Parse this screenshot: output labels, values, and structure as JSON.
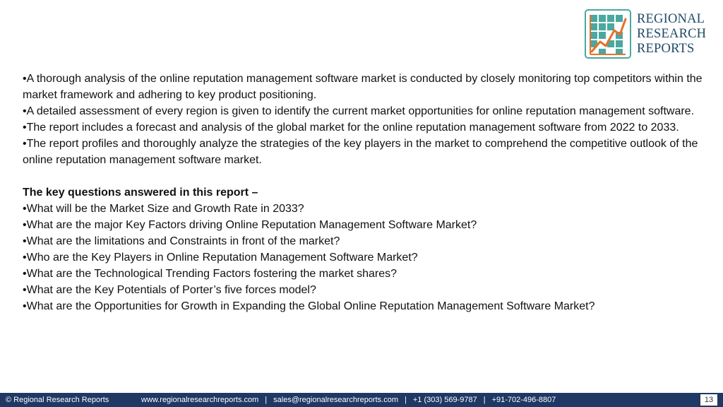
{
  "logo": {
    "icon": "bar-chart-growth-icon",
    "line1": "REGIONAL",
    "line2": "RESEARCH",
    "line3": "REPORTS",
    "colors": {
      "teal": "#4aa8a0",
      "orange": "#e8702a",
      "navy": "#1f4a66"
    }
  },
  "bullets": [
    "•A thorough analysis of the online reputation management software market is conducted by closely monitoring top competitors within the market framework and adhering to key product positioning.",
    "•A detailed assessment of every region is given to identify the current market opportunities for online reputation management software.",
    "•The report includes a forecast and analysis of the global market for the online reputation management software from 2022 to 2033.",
    "•The report profiles and thoroughly analyze the strategies of the key players in the market to comprehend the competitive outlook of the online reputation management software market."
  ],
  "questions_heading": "The key questions answered in this report –",
  "questions": [
    "•What will be the Market Size and Growth Rate in 2033?",
    "•What are the major Key Factors driving Online Reputation Management Software Market?",
    "•What are the limitations and Constraints in front of the market?",
    "•Who are the Key Players in Online Reputation Management Software Market?",
    "•What are the Technological Trending Factors fostering the market shares?",
    "•What are the Key Potentials of Porter’s five forces model?",
    "•What are the Opportunities for Growth in Expanding the Global Online Reputation Management Software Market?"
  ],
  "footer": {
    "copyright": "© Regional Research Reports",
    "website": "www.regionalresearchreports.com",
    "email": "sales@regionalresearchreports.com",
    "phone1": "+1 (303) 569-9787",
    "phone2": "+91-702-496-8807",
    "separator": "|",
    "page_number": "13",
    "bg_color": "#1f3864"
  }
}
